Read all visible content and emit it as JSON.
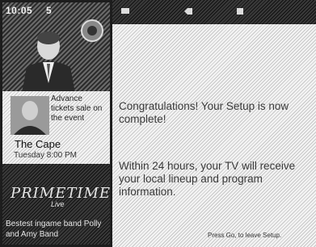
{
  "video": {
    "time": "10:05",
    "channel": "5"
  },
  "ad": {
    "text": "Advance tickets sale on the event",
    "title": "The Cape",
    "schedule": "Tuesday 8:00 PM"
  },
  "primetime": {
    "logo": "PRIMETIME",
    "subtitle": "Live",
    "blurb": "Bestest ingame band Polly and Amy Band"
  },
  "main": {
    "message1": "Congratulations! Your Setup is now complete!",
    "message2": "Within 24 hours, your TV will receive your local lineup and program information.",
    "exit_hint": "Press Go, to leave Setup."
  },
  "icons": [
    "tv-icon",
    "tag-icon",
    "flag-icon"
  ],
  "colors": {
    "sidebar_bg": "#1d1d1d",
    "main_bg": "#efefef",
    "text": "#3a3a3a"
  }
}
